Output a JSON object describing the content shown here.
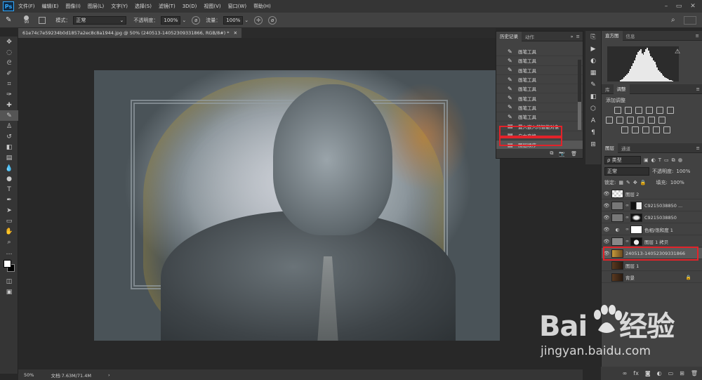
{
  "app": {
    "logo": "Ps"
  },
  "menu": [
    "文件(F)",
    "编辑(E)",
    "图像(I)",
    "图层(L)",
    "文字(Y)",
    "选择(S)",
    "滤镜(T)",
    "3D(D)",
    "视图(V)",
    "窗口(W)",
    "帮助(H)"
  ],
  "options": {
    "brush_size": "90",
    "mode_label": "模式：",
    "mode_value": "正常",
    "opacity_label": "不透明度：",
    "opacity_value": "100%",
    "flow_label": "流量：",
    "flow_value": "100%"
  },
  "document": {
    "tab_title": "61e74c7e59234b0d1857a2ec8c8a1944.jpg @ 50% (240513-14052309331866, RGB/8#) *",
    "zoom": "50%",
    "doc_size": "文档:7.63M/71.4M"
  },
  "history_panel": {
    "tabs": [
      "历史记录",
      "动作"
    ],
    "items": [
      "画笔工具",
      "画笔工具",
      "画笔工具",
      "画笔工具",
      "画笔工具",
      "画笔工具",
      "画笔工具",
      "画笔工具",
      "置入嵌入的智能对象",
      "自由变换",
      "图层顺序"
    ]
  },
  "top_right_panel": {
    "tabs": [
      "直方图",
      "信息"
    ]
  },
  "adjust_panel": {
    "tabs": [
      "库",
      "调整"
    ],
    "add_label": "添加调整"
  },
  "layers_panel": {
    "tabs": [
      "图层",
      "通道"
    ],
    "filter_label": "ρ 类型",
    "blend_mode": "正常",
    "opacity_label": "不透明度:",
    "opacity_value": "100%",
    "lock_label": "锁定:",
    "fill_label": "填充:",
    "fill_value": "100%",
    "layers": [
      {
        "name": "图层 2"
      },
      {
        "name": "C9215038850 ..."
      },
      {
        "name": "C9215038850"
      },
      {
        "name": "色相/饱和度 1"
      },
      {
        "name": "图层 1 拷贝"
      },
      {
        "name": "240513-14052309331866"
      },
      {
        "name": "图层 1"
      },
      {
        "name": "背景"
      }
    ]
  },
  "watermark": {
    "brand": "Bai",
    "brand2": "经验",
    "url": "jingyan.baidu.com"
  },
  "colors": {
    "highlight": "#e2232a",
    "selected_layer": "#5a5a5a",
    "accent": "#31a8ff"
  }
}
